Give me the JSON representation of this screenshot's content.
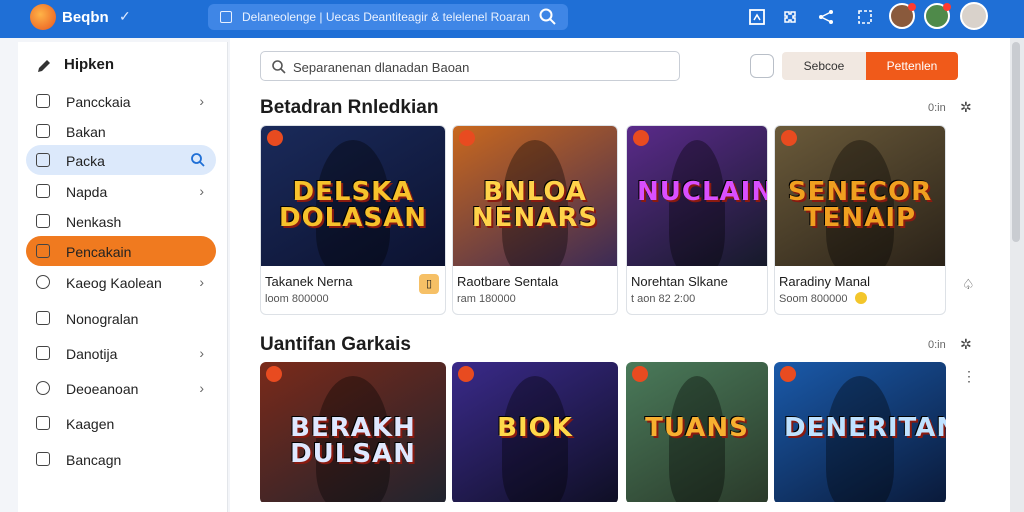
{
  "topbar": {
    "app_name": "Beqbn",
    "search_text": "Delaneolenge | Uecas Deantiteagir & telelenel Roaran",
    "icons": [
      "logo-icon",
      "check-icon",
      "search-icon",
      "square-icon",
      "puzzle-icon",
      "share-icon",
      "crop-icon"
    ],
    "accent": "#1f6fd6"
  },
  "sidebar": {
    "header": "Hipken",
    "items": [
      {
        "label": "Pancckaia",
        "icon": "image-icon",
        "chevron": true
      },
      {
        "label": "Bakan",
        "icon": "home-icon",
        "chevron": false
      },
      {
        "label": "Packa",
        "icon": "house-icon",
        "chevron": false,
        "search": true
      },
      {
        "label": "Napda",
        "icon": "file-icon",
        "chevron": true
      },
      {
        "label": "Nenkash",
        "icon": "box-icon",
        "chevron": false
      },
      {
        "label": "Pencakain",
        "icon": "list-icon",
        "chevron": false
      },
      {
        "label": "Kaeog Kaolean",
        "icon": "clock-icon",
        "chevron": true
      },
      {
        "label": "Nonogralan",
        "icon": "square-icon",
        "chevron": false
      },
      {
        "label": "Danotija",
        "icon": "link-icon",
        "chevron": true
      },
      {
        "label": "Deoeanoan",
        "icon": "chat-icon",
        "chevron": true
      },
      {
        "label": "Kaagen",
        "icon": "note-icon",
        "chevron": false
      },
      {
        "label": "Bancagn",
        "icon": "tag-icon",
        "chevron": false
      }
    ],
    "selected_index": 2,
    "active_index": 5
  },
  "main": {
    "filter_placeholder": "Separanenan dlanadan Baoan",
    "btn_light": "Sebcoe",
    "btn_orange": "Pettenlen",
    "sections": [
      {
        "title": "Betadran Rnledkian",
        "meta": "0:in",
        "cards": [
          {
            "art": "DELSKA DOLASAN",
            "name": "Takanek Nerna",
            "meta": "loom 800000",
            "tag": true
          },
          {
            "art": "BNLOA NENARS",
            "name": "Raotbare Sentala",
            "meta": "ram 180000"
          },
          {
            "art": "NUCLAIN",
            "name": "Norehtan Slkane",
            "meta": "t aon 82 2:00"
          },
          {
            "art": "SENECOR TENAIP",
            "name": "Raradiny Manal",
            "meta": "Soom 800000",
            "gold": true
          }
        ]
      },
      {
        "title": "Uantifan Garkais",
        "meta": "0:in",
        "cards": [
          {
            "art": "BERAKH DULSAN"
          },
          {
            "art": "BIOK"
          },
          {
            "art": "TUANS"
          },
          {
            "art": "DENERITAN"
          }
        ]
      }
    ]
  }
}
